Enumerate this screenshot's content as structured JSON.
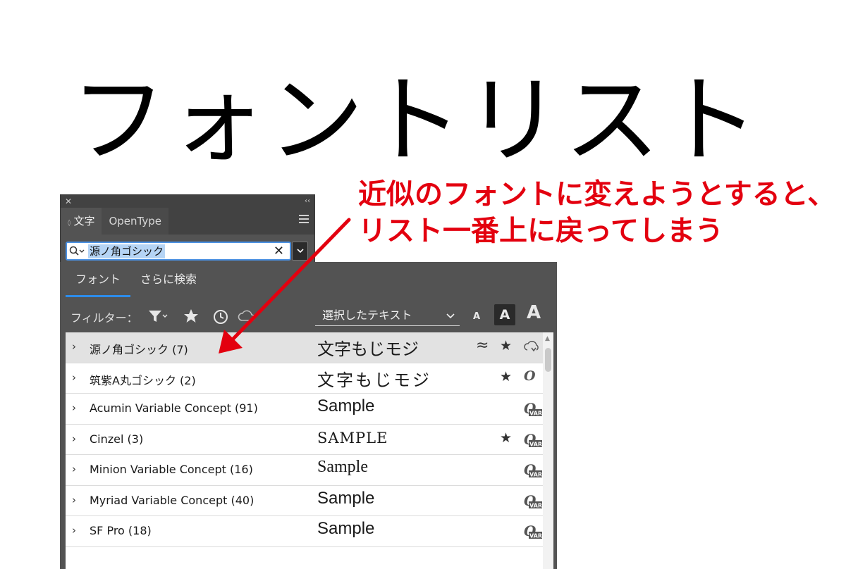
{
  "headline": "フォントリスト",
  "annotation": {
    "line1": "近似のフォントに変えようとすると、",
    "line2": "リスト一番上に戻ってしまう",
    "color": "#e3000f"
  },
  "panel": {
    "close_glyph": "✕",
    "collapse_glyph": "‹‹",
    "tabs": [
      {
        "label": "文字",
        "active": true
      },
      {
        "label": "OpenType",
        "active": false
      }
    ],
    "search": {
      "value": "源ノ角ゴシック",
      "clear_glyph": "✕"
    }
  },
  "font_menu": {
    "tabs": [
      {
        "label": "フォント",
        "active": true
      },
      {
        "label": "さらに検索",
        "active": false
      }
    ],
    "filter_label": "フィルター：",
    "preview_select": "選択したテキスト",
    "size_labels": [
      "A",
      "A",
      "A"
    ],
    "fonts": [
      {
        "name": "源ノ角ゴシック (7)",
        "sample": "文字もじモジ",
        "similar": "≈",
        "favorite": true,
        "type_icon": "cloud-sync-icon",
        "selected": true
      },
      {
        "name": "筑紫A丸ゴシック (2)",
        "sample": "文字もじモジ",
        "favorite": true,
        "type_icon": "opentype-icon",
        "type_label": "O"
      },
      {
        "name": "Acumin Variable Concept (91)",
        "sample": "Sample",
        "favorite": false,
        "type_icon": "variable-font-icon"
      },
      {
        "name": "Cinzel (3)",
        "sample": "SAMPLE",
        "favorite": true,
        "type_icon": "variable-font-icon"
      },
      {
        "name": "Minion Variable Concept (16)",
        "sample": "Sample",
        "favorite": false,
        "type_icon": "variable-font-icon"
      },
      {
        "name": "Myriad Variable Concept (40)",
        "sample": "Sample",
        "favorite": false,
        "type_icon": "variable-font-icon"
      },
      {
        "name": "SF Pro (18)",
        "sample": "Sample",
        "favorite": false,
        "type_icon": "variable-font-icon"
      }
    ],
    "star_glyph": "★",
    "row_chevron": "›",
    "var_label": "VAR"
  }
}
